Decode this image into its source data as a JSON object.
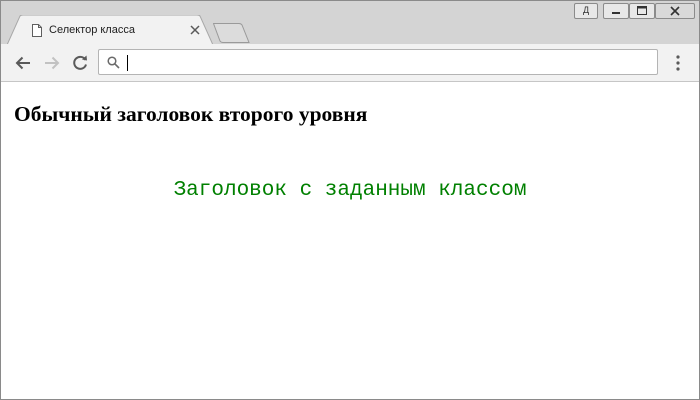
{
  "window": {
    "tab_title": "Селектор класса",
    "profile_label": "Д",
    "address": ""
  },
  "page": {
    "heading_plain": "Обычный заголовок второго уровня",
    "heading_class": "Заголовок с заданным классом"
  },
  "colors": {
    "class_heading": "#008000",
    "titlebar": "#d4d4d4",
    "toolbar": "#f2f2f2"
  },
  "icons": {
    "tab": "document-icon",
    "close": "close-icon",
    "back": "arrow-left-icon",
    "forward": "arrow-right-icon",
    "reload": "reload-icon",
    "search": "search-icon",
    "menu": "kebab-menu-icon"
  }
}
